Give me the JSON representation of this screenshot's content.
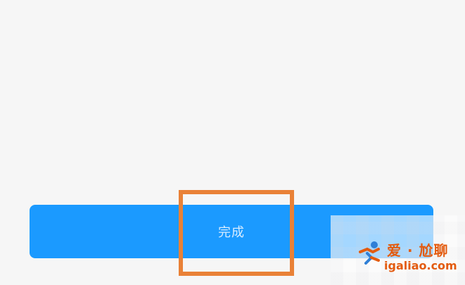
{
  "button": {
    "label": "完成"
  },
  "watermark": {
    "title": "爱 · 尬聊",
    "url": "igaliao.com"
  },
  "colors": {
    "background": "#f6f6f6",
    "button": "#1b9aff",
    "button_text": "#d7ecff",
    "highlight": "#e98137",
    "watermark": "#e35b0f"
  }
}
